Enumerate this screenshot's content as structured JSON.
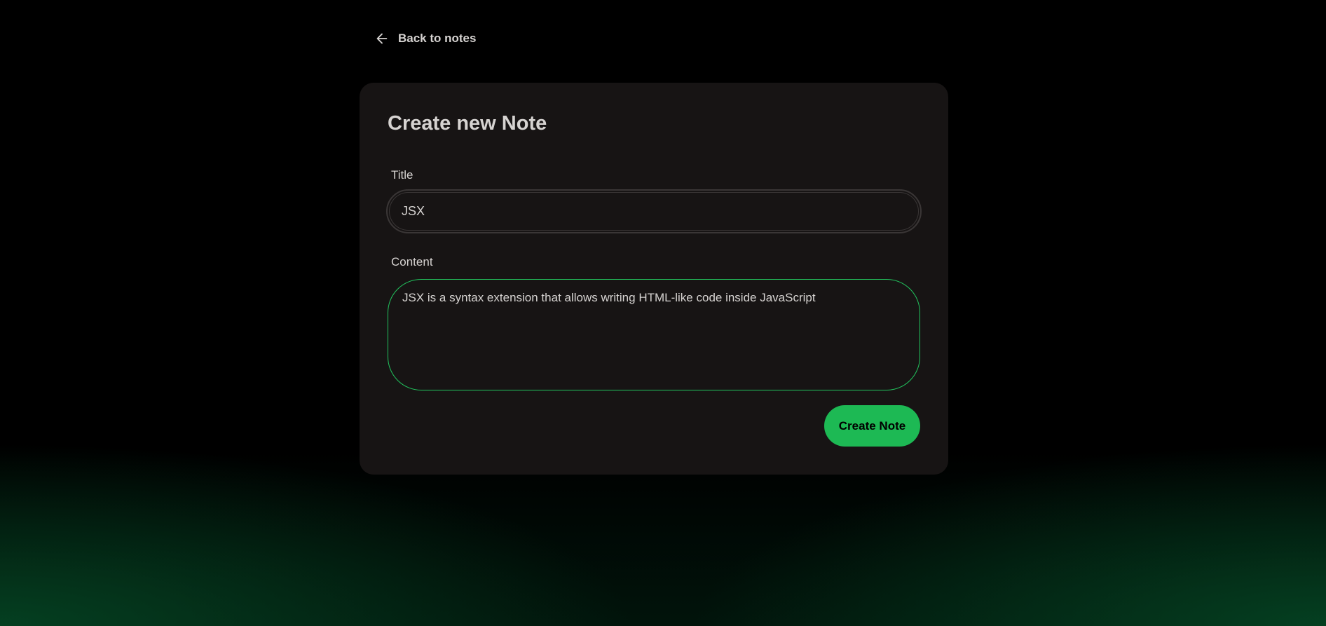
{
  "nav": {
    "back_label": "Back to notes"
  },
  "form": {
    "heading": "Create new Note",
    "title_label": "Title",
    "title_value": "JSX",
    "content_label": "Content",
    "content_value": "JSX is a syntax extension that allows writing HTML-like code inside JavaScript",
    "submit_label": "Create Note"
  },
  "colors": {
    "accent": "#1db954",
    "focus_border": "#22c55e",
    "card": "#171414"
  }
}
